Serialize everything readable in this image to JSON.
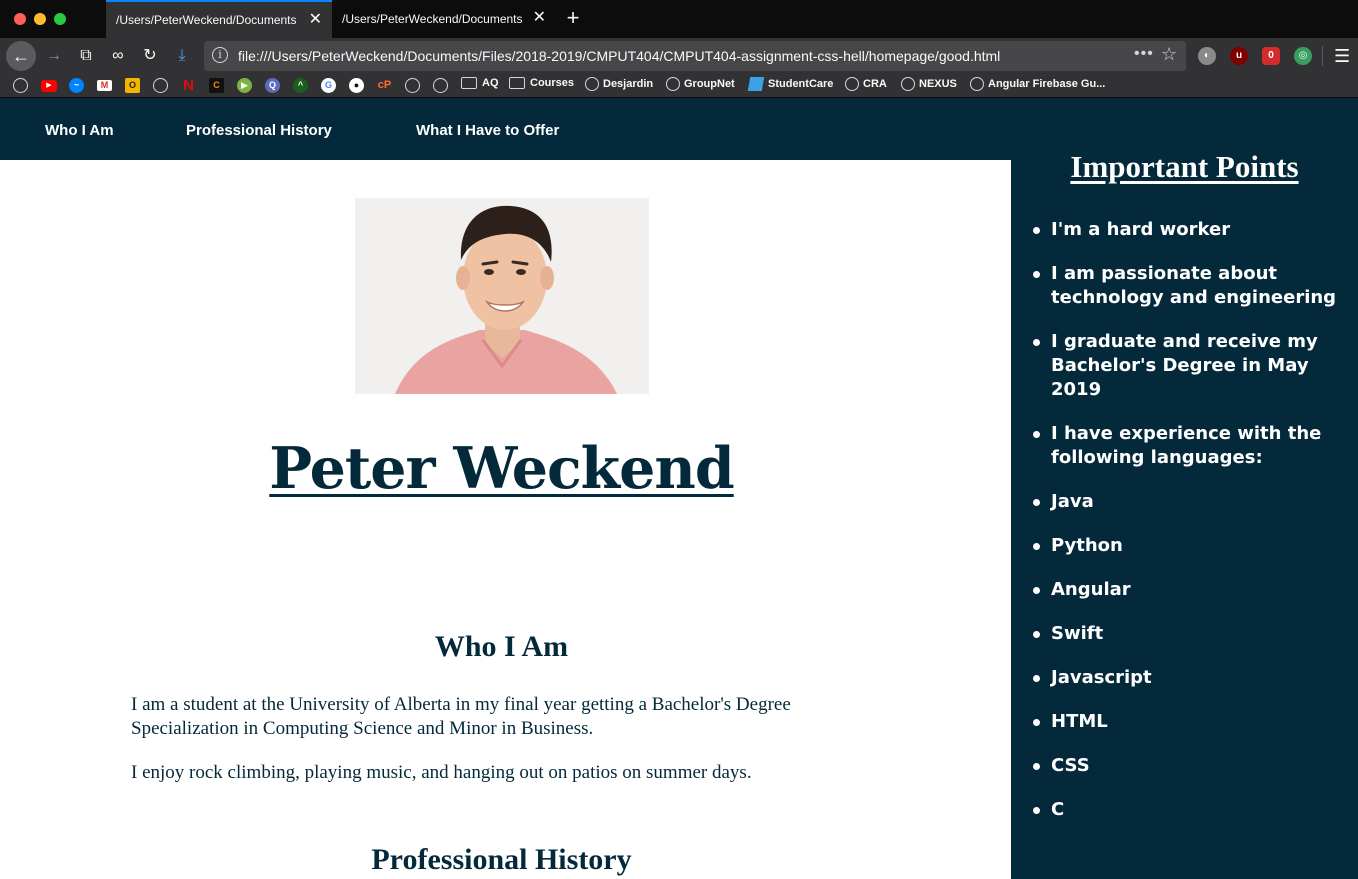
{
  "browser": {
    "tabs": [
      {
        "label": "/Users/PeterWeckend/Documents/F"
      },
      {
        "label": "/Users/PeterWeckend/Documents/F"
      }
    ],
    "url": "file:///Users/PeterWeckend/Documents/Files/2018-2019/CMPUT404/CMPUT404-assignment-css-hell/homepage/good.html",
    "bookmarks": [
      {
        "label": "AQ",
        "icon": "folder-icon"
      },
      {
        "label": "Courses",
        "icon": "folder-icon"
      },
      {
        "label": "Desjardin",
        "icon": "globe-icon"
      },
      {
        "label": "GroupNet",
        "icon": "globe-icon"
      },
      {
        "label": "StudentCare",
        "icon": "studentcare-icon"
      },
      {
        "label": "CRA",
        "icon": "globe-icon"
      },
      {
        "label": "NEXUS",
        "icon": "globe-icon"
      },
      {
        "label": "Angular Firebase Gu...",
        "icon": "globe-icon"
      }
    ],
    "colors": {
      "accent": "#0a84ff",
      "chrome": "#323234"
    }
  },
  "site": {
    "nav": [
      "Who I Am",
      "Professional History",
      "What I Have to Offer"
    ],
    "name": "Peter Weckend",
    "sections": {
      "who_title": "Who I Am",
      "who_p1": "I am a student at the University of Alberta in my final year getting a Bachelor's Degree Specialization in Computing Science and Minor in Business.",
      "who_p2": "I enjoy rock climbing, playing music, and hanging out on patios on summer days.",
      "history_title": "Professional History"
    },
    "sidebar": {
      "title": "Important Points",
      "points": [
        "I'm a hard worker",
        "I am passionate about technology and engineering",
        "I graduate and receive my Bachelor's Degree in May 2019",
        "I have experience with the following languages:",
        "Java",
        "Python",
        "Angular",
        "Swift",
        "Javascript",
        "HTML",
        "CSS",
        "C"
      ]
    },
    "colors": {
      "primary": "#04293b",
      "background": "#ffffff"
    }
  }
}
